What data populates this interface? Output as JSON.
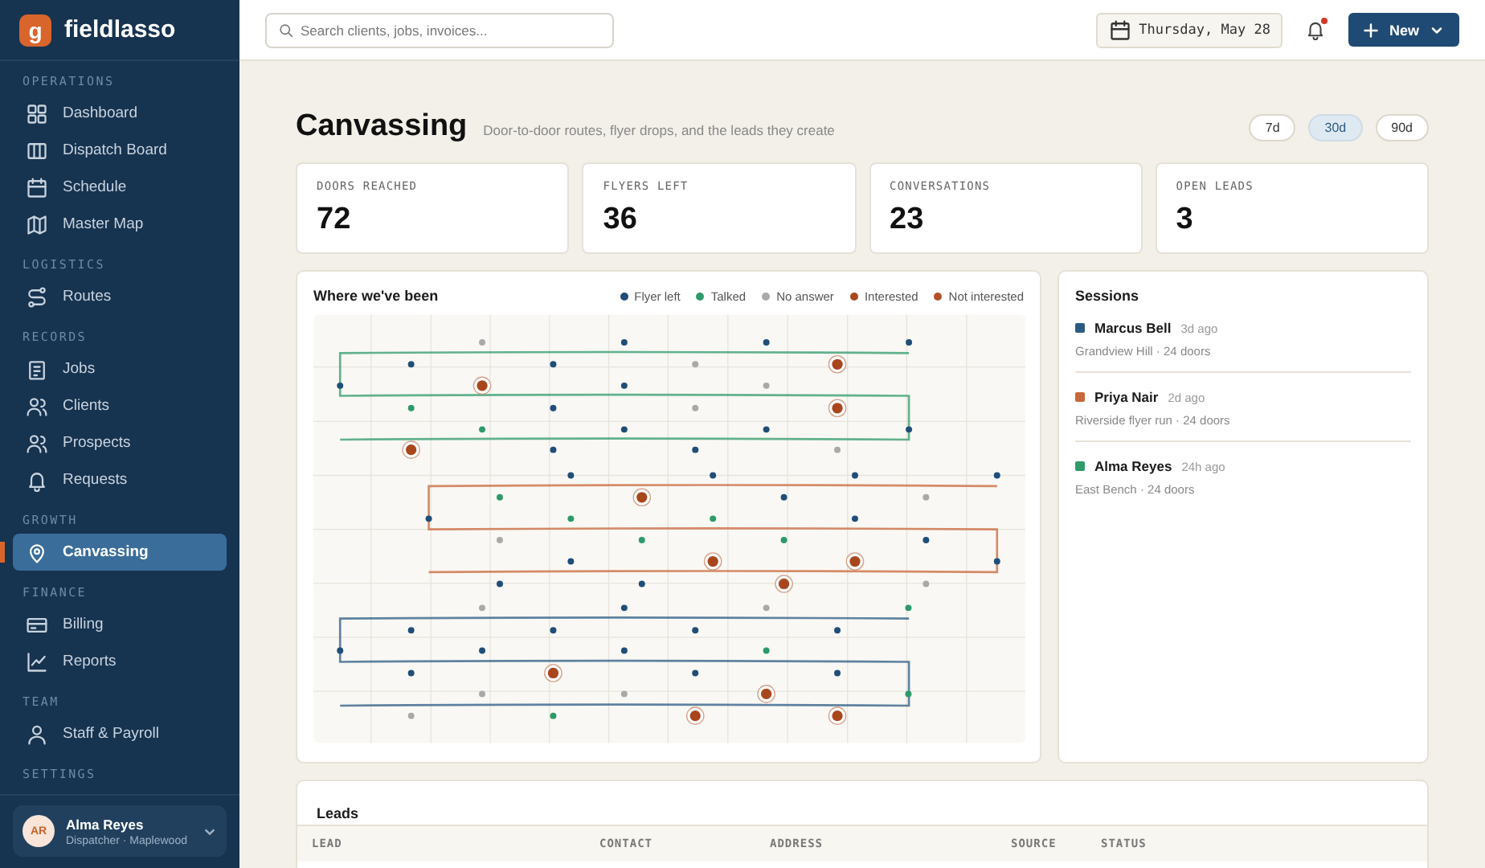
{
  "app": {
    "logo_mark": "g",
    "name": "fieldlasso"
  },
  "sidebar": {
    "sections": [
      {
        "label": "OPERATIONS",
        "items": [
          {
            "label": "Dashboard",
            "selected": false
          },
          {
            "label": "Dispatch Board",
            "selected": false
          },
          {
            "label": "Schedule",
            "selected": false
          },
          {
            "label": "Master Map",
            "selected": false
          }
        ]
      },
      {
        "label": "LOGISTICS",
        "items": [
          {
            "label": "Routes",
            "selected": false
          }
        ]
      },
      {
        "label": "RECORDS",
        "items": [
          {
            "label": "Jobs",
            "selected": false
          },
          {
            "label": "Clients",
            "selected": false
          },
          {
            "label": "Prospects",
            "selected": false
          },
          {
            "label": "Requests",
            "selected": false
          }
        ]
      },
      {
        "label": "GROWTH",
        "items": [
          {
            "label": "Canvassing",
            "selected": true
          }
        ]
      },
      {
        "label": "FINANCE",
        "items": [
          {
            "label": "Billing",
            "selected": false
          },
          {
            "label": "Reports",
            "selected": false
          }
        ]
      },
      {
        "label": "TEAM",
        "items": [
          {
            "label": "Staff & Payroll",
            "selected": false
          }
        ]
      },
      {
        "label": "SETTINGS"
      }
    ],
    "user": {
      "initials": "AR",
      "name": "Alma Reyes",
      "role": "Dispatcher · Maplewood"
    }
  },
  "topbar": {
    "search": {
      "placeholder": "Search clients, jobs, invoices..."
    },
    "date": "Thursday, May 28",
    "notifications": {
      "unread": true
    },
    "new_button": "New"
  },
  "page": {
    "title": "Canvassing",
    "subtitle": "Door-to-door routes, flyer drops, and the leads they create",
    "ranges": [
      {
        "label": "7d",
        "selected": false
      },
      {
        "label": "30d",
        "selected": true
      },
      {
        "label": "90d",
        "selected": false
      }
    ]
  },
  "stats": [
    {
      "label": "DOORS REACHED",
      "value": "72"
    },
    {
      "label": "FLYERS LEFT",
      "value": "36"
    },
    {
      "label": "CONVERSATIONS",
      "value": "23"
    },
    {
      "label": "OPEN LEADS",
      "value": "3"
    }
  ],
  "map": {
    "title": "Where we've been",
    "legend": [
      {
        "label": "Flyer left",
        "color": "#1f4e79"
      },
      {
        "label": "Talked",
        "color": "#2e9a6a"
      },
      {
        "label": "No answer",
        "color": "#a9a9a9"
      },
      {
        "label": "Interested",
        "color": "#a9461c"
      },
      {
        "label": "Not interested",
        "color": "#b2502a"
      }
    ]
  },
  "sessions": {
    "title": "Sessions",
    "items": [
      {
        "name": "Marcus Bell",
        "ago": "3d ago",
        "detail": "Grandview Hill · 24 doors",
        "color": "#2b5b84"
      },
      {
        "name": "Priya Nair",
        "ago": "2d ago",
        "detail": "Riverside flyer run · 24 doors",
        "color": "#c8673a"
      },
      {
        "name": "Alma Reyes",
        "ago": "24h ago",
        "detail": "East Bench · 24 doors",
        "color": "#2f9a6a"
      }
    ]
  },
  "leads": {
    "title": "Leads",
    "columns": [
      "LEAD",
      "CONTACT",
      "ADDRESS",
      "SOURCE",
      "STATUS"
    ]
  }
}
